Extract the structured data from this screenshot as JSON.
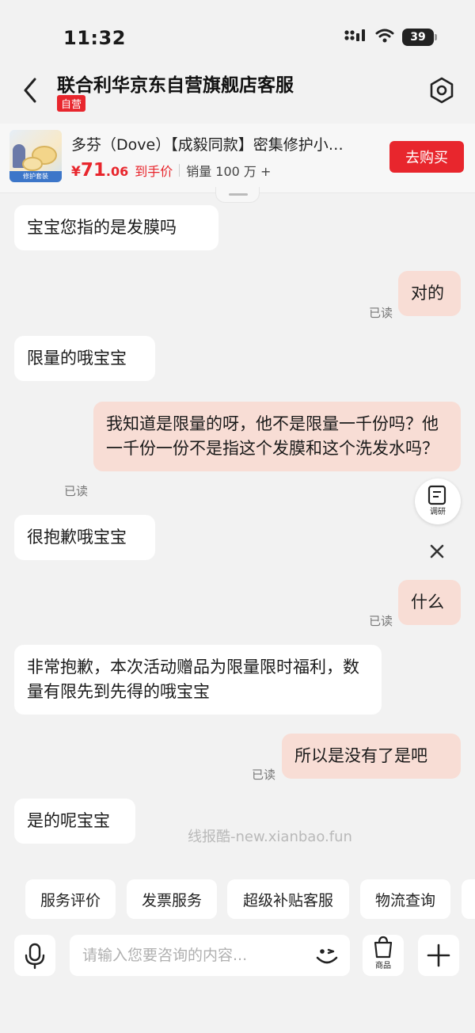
{
  "status_bar": {
    "time": "11:32",
    "battery": "39"
  },
  "header": {
    "title": "联合利华京东自营旗舰店客服",
    "self_tag": "自营"
  },
  "product": {
    "title": "多芬（Dove）【成毅同款】密集修护小…",
    "thumb_band": "修护套装",
    "currency": "¥",
    "price_int": "71",
    "price_dec": ".06",
    "price_tag": "到手价",
    "sales": "销量 100 万 +",
    "buy_label": "去购买"
  },
  "messages": [
    {
      "side": "left",
      "text": "宝宝您指的是发膜吗"
    },
    {
      "side": "right",
      "text": "对的",
      "read": "已读"
    },
    {
      "side": "left",
      "text": "限量的哦宝宝"
    },
    {
      "side": "right",
      "text": "我知道是限量的呀，他不是限量一千份吗？他一千份一份不是指这个发膜和这个洗发水吗？",
      "read": "已读"
    },
    {
      "side": "left",
      "text": "很抱歉哦宝宝"
    },
    {
      "side": "right",
      "text": "什么",
      "read": "已读"
    },
    {
      "side": "left",
      "text": "非常抱歉，本次活动赠品为限量限时福利，数量有限先到先得的哦宝宝"
    },
    {
      "side": "right",
      "text": "所以是没有了是吧",
      "read": "已读"
    },
    {
      "side": "left",
      "text": "是的呢宝宝"
    }
  ],
  "survey_label": "调研",
  "watermark": "线报酷-new.xianbao.fun",
  "quick_actions": [
    "服务评价",
    "发票服务",
    "超级补贴客服",
    "物流查询"
  ],
  "input": {
    "placeholder": "请输入您要咨询的内容...",
    "goods_label": "商品"
  }
}
